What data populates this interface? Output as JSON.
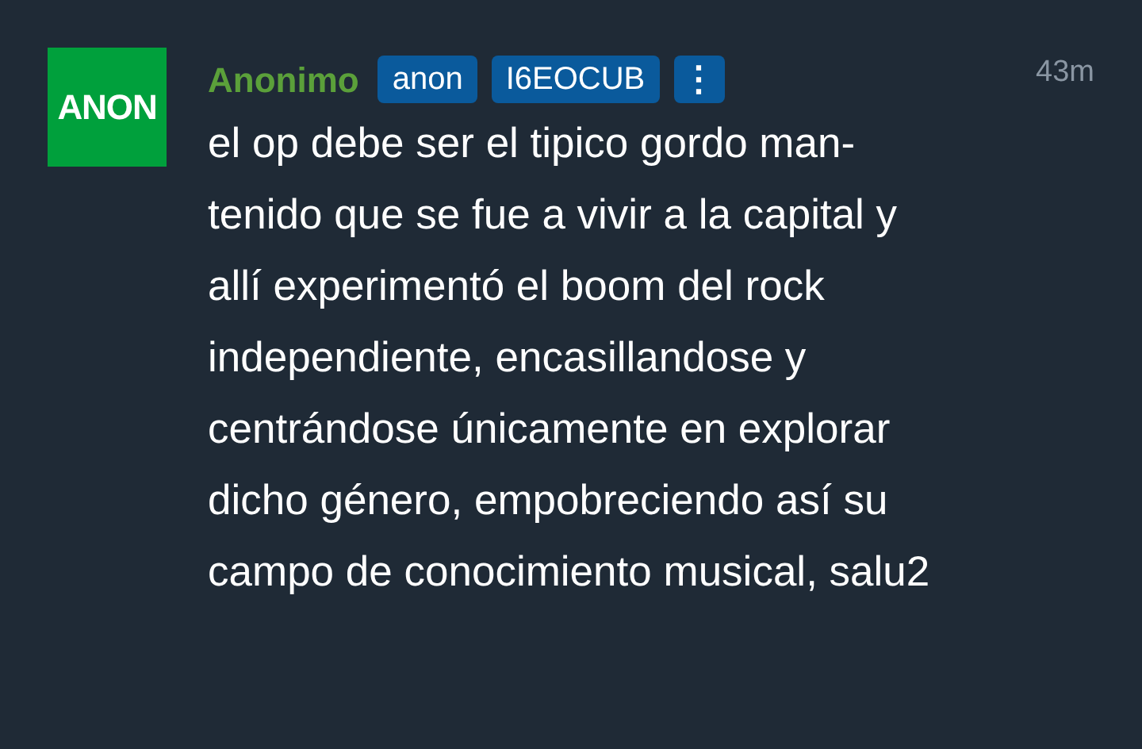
{
  "avatar": {
    "text": "ANON"
  },
  "author": "Anonimo",
  "badges": [
    "anon",
    "I6EOCUB"
  ],
  "menu_button": {
    "label": "⋮"
  },
  "time": "43m",
  "body": "el op debe ser el tipico gordo man-\ntenido que se fue a vivir a la capital y\nallí experimentó el boom del rock\nindependiente, encasillandose y\ncentrándose únicamente en explorar\ndicho género, empobreciendo así su\ncampo de conocimiento musical, salu2"
}
